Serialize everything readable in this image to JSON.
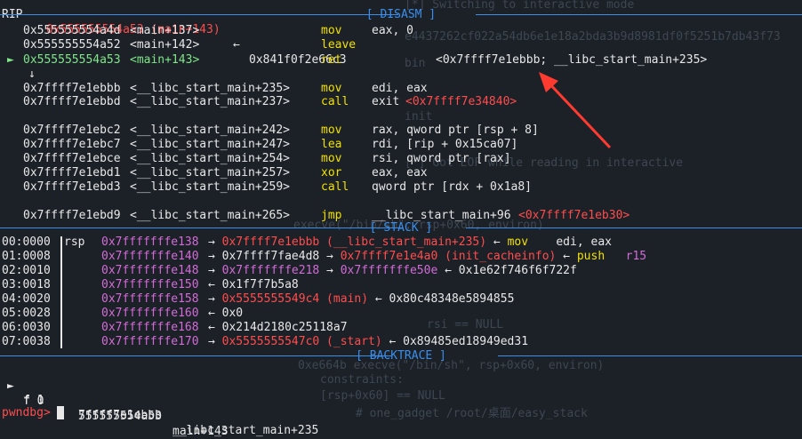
{
  "top_partial": {
    "label": "RIP",
    "value": "0x555555554a53 (main+143)",
    "arrow": "←",
    "target": "0x841f0f2e66c3"
  },
  "disasm": {
    "header": "[ DISASM ]",
    "rows": [
      {
        "marker": "",
        "addr": "0x555555554a4d",
        "sym": "<main+137>",
        "mn": "mov",
        "op": "eax, 0",
        "cur": false
      },
      {
        "marker": "",
        "addr": "0x555555554a52",
        "sym": "<main+142>",
        "mn": "leave",
        "op": "",
        "cur": false
      },
      {
        "marker": "►",
        "addr": "0x555555554a53",
        "sym": "<main+143>",
        "mn": "ret",
        "op": "",
        "cur": true
      },
      {
        "marker": "↓",
        "addr": "",
        "sym": "",
        "mn": "",
        "op": "",
        "cur": false
      },
      {
        "marker": "",
        "addr": "0x7ffff7e1ebbb",
        "sym": "<__libc_start_main+235>",
        "mn": "mov",
        "op": "edi, eax",
        "cur": false
      },
      {
        "marker": "",
        "addr": "0x7ffff7e1ebbd",
        "sym": "<__libc_start_main+237>",
        "mn": "call",
        "op": "exit",
        "cur": false
      },
      {
        "marker": "",
        "addr": "0x7ffff7e1ebc2",
        "sym": "<__libc_start_main+242>",
        "mn": "mov",
        "op": "rax, qword ptr [rsp + 8]",
        "cur": false
      },
      {
        "marker": "",
        "addr": "0x7ffff7e1ebc7",
        "sym": "<__libc_start_main+247>",
        "mn": "lea",
        "op": "rdi, [rip + 0x15ca07]",
        "cur": false
      },
      {
        "marker": "",
        "addr": "0x7ffff7e1ebce",
        "sym": "<__libc_start_main+254>",
        "mn": "mov",
        "op": "rsi, qword ptr [rax]",
        "cur": false
      },
      {
        "marker": "",
        "addr": "0x7ffff7e1ebd1",
        "sym": "<__libc_start_main+257>",
        "mn": "xor",
        "op": "eax, eax",
        "cur": false
      },
      {
        "marker": "",
        "addr": "0x7ffff7e1ebd3",
        "sym": "<__libc_start_main+259>",
        "mn": "call",
        "op": "qword ptr [rdx + 0x1a8]",
        "cur": false
      },
      {
        "marker": "",
        "addr": "0x7ffff7e1ebd9",
        "sym": "<__libc_start_main+265>",
        "mn": "jmp",
        "op": "__libc_start_main+96",
        "cur": false
      }
    ],
    "ret_target": "<0x7ffff7e1ebbb; __libc_start_main+235>",
    "exit_target": "<0x7ffff7e34840>",
    "jmp_target": "<0x7ffff7e1eb30>"
  },
  "stack": {
    "header": "[ STACK ]",
    "rows": [
      {
        "idx": "00:0000",
        "reg": "rsp",
        "addr": "0x7fffffffe138",
        "rest": [
          [
            "→ ",
            "w"
          ],
          [
            "0x7ffff7e1ebbb (__libc_start_main+235)",
            "r"
          ],
          [
            " ← ",
            "w"
          ],
          [
            "mov",
            "y"
          ],
          [
            "    edi, eax",
            "w"
          ]
        ]
      },
      {
        "idx": "01:0008",
        "reg": "",
        "addr": "0x7fffffffe140",
        "rest": [
          [
            "→ 0x7ffff7fae4d8 → ",
            "w"
          ],
          [
            "0x7ffff7e1e4a0 (init_cacheinfo)",
            "r"
          ],
          [
            " ← ",
            "w"
          ],
          [
            "push",
            "y"
          ],
          [
            "   r15",
            "m"
          ]
        ]
      },
      {
        "idx": "02:0010",
        "reg": "",
        "addr": "0x7fffffffe148",
        "rest": [
          [
            "→ ",
            "w"
          ],
          [
            "0x7fffffffe218",
            "m"
          ],
          [
            " → ",
            "w"
          ],
          [
            "0x7fffffffe50e",
            "m"
          ],
          [
            " ← 0x1e62f746f6f722f",
            "w"
          ]
        ]
      },
      {
        "idx": "03:0018",
        "reg": "",
        "addr": "0x7fffffffe150",
        "rest": [
          [
            "← 0x1f7f7b5a8",
            "w"
          ]
        ]
      },
      {
        "idx": "04:0020",
        "reg": "",
        "addr": "0x7fffffffe158",
        "rest": [
          [
            "→ ",
            "w"
          ],
          [
            "0x5555555549c4 (main)",
            "r"
          ],
          [
            " ← 0x80c48348e5894855",
            "w"
          ]
        ]
      },
      {
        "idx": "05:0028",
        "reg": "",
        "addr": "0x7fffffffe160",
        "rest": [
          [
            "← 0x0",
            "w"
          ]
        ]
      },
      {
        "idx": "06:0030",
        "reg": "",
        "addr": "0x7fffffffe168",
        "rest": [
          [
            "← 0x214d2180c25118a7",
            "w"
          ]
        ]
      },
      {
        "idx": "07:0038",
        "reg": "",
        "addr": "0x7fffffffe170",
        "rest": [
          [
            "→ ",
            "w"
          ],
          [
            "0x5555555547c0 (_start)",
            "r"
          ],
          [
            " ← 0x89485ed18949ed31",
            "w"
          ]
        ]
      }
    ]
  },
  "backtrace": {
    "header": "[ BACKTRACE ]",
    "frames": [
      {
        "marker": "►",
        "frame": "f 0",
        "addr": "555555554a53",
        "sym": "main+143"
      },
      {
        "marker": "",
        "frame": "f 1",
        "addr": "7ffff7e1ebbb",
        "sym": "__libc_start_main+235"
      }
    ]
  },
  "prompt": "pwndbg> ",
  "ghost_text": [
    "[*] Switching to interactive mode",
    "e4437262cf022a54db6e1e18a2bda3b9d8981df0f5251b7db43f73",
    "bin",
    "init",
    "[*] Got EOF while reading in interactive",
    "execve(\"/bin/sh\", rsp+0x60, environ)",
    "rsi == NULL",
    "0xe664b execve(\"/bin/sh\", rsp+0x60, environ)",
    "constraints:",
    "[rsp+0x60] == NULL",
    "# one_gadget /root/桌面/easy_stack"
  ],
  "colors": {
    "background": "#1c2128",
    "header": "#3b8eea",
    "current_instruction": "#7ee787",
    "mnemonic": "#f0e000",
    "code_pointer": "#ff4d4d",
    "stack_pointer": "#d26cd6",
    "annotation_arrow": "#ff3b30"
  }
}
